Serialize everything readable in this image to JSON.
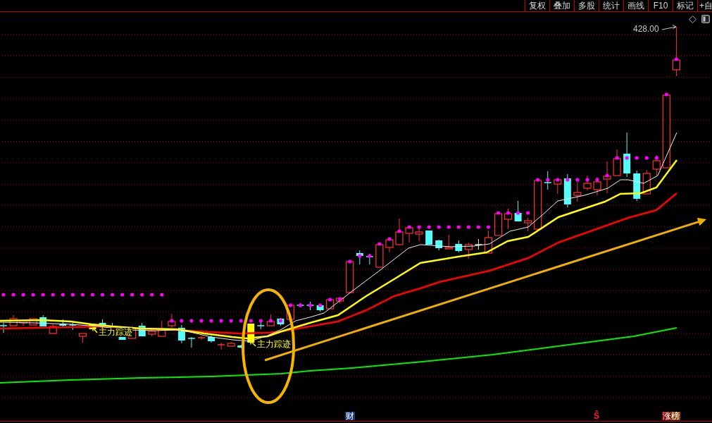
{
  "toolbar": {
    "buttons": [
      {
        "label": "复权"
      },
      {
        "label": "叠加"
      },
      {
        "label": "多股"
      },
      {
        "label": "统计"
      },
      {
        "label": "画线"
      },
      {
        "label": "F10"
      },
      {
        "label": "标记"
      },
      {
        "label": "+自"
      }
    ]
  },
  "chart": {
    "price_label": "428.00",
    "annotations": [
      {
        "text": "主力踪迹"
      },
      {
        "text": "主力踪迹"
      }
    ],
    "event_markers": [
      {
        "kind": "finance",
        "text": "财"
      },
      {
        "kind": "signal",
        "text": "Ŝ"
      },
      {
        "kind": "limit_up",
        "text": "涨榜"
      }
    ]
  }
}
